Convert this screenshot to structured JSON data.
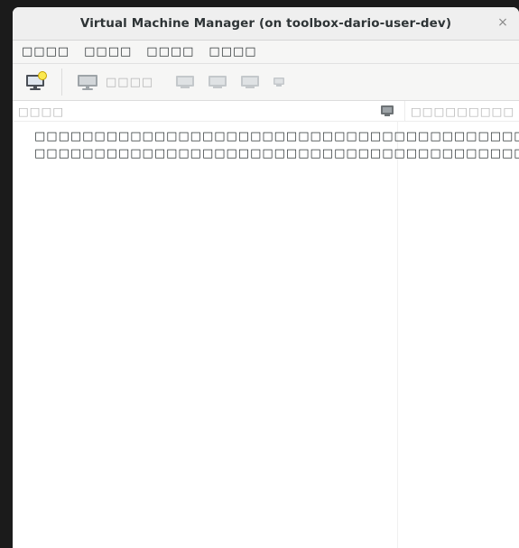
{
  "window": {
    "title": "Virtual Machine Manager (on toolbox-dario-user-dev)",
    "close_glyph": "×"
  },
  "menubar": {
    "items": [
      "□□□□",
      "□□□□",
      "□□□□",
      "□□□□"
    ]
  },
  "toolbar": {
    "new_vm_icon": "new-vm-icon",
    "open_label": "□□□□",
    "buttons": [
      {
        "icon": "monitor-icon"
      },
      {
        "icon": "run-icon"
      },
      {
        "icon": "pause-icon"
      },
      {
        "icon": "shutdown-icon"
      },
      {
        "icon": "shutdown-menu-icon"
      }
    ]
  },
  "list": {
    "name_header": "□□□□",
    "cpu_header": "□□□□□□□□□",
    "message_line1": "□□□□□□□□□□□□□□□□□□□□□□□□□□□□□□□□□□□□□□□□□□□□",
    "message_line2": "□□□□□□□□□□□□□□□□□□□□□□□□□□□□□□□□□□□□□□□□□□"
  }
}
